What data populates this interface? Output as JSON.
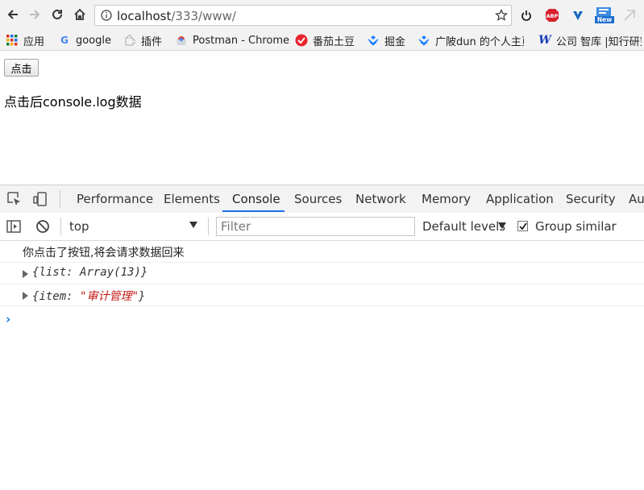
{
  "browser": {
    "url_host": "localhost",
    "url_path": "/333/www/",
    "bookmarks": [
      {
        "label": "应用",
        "icon": "apps-grid-icon"
      },
      {
        "label": "google",
        "icon": "google-icon"
      },
      {
        "label": "插件",
        "icon": "puzzle-icon"
      },
      {
        "label": "Postman - Chrome",
        "icon": "chrome-webstore-icon"
      },
      {
        "label": "番茄土豆",
        "icon": "tomato-icon"
      },
      {
        "label": "掘金",
        "icon": "juejin-icon"
      },
      {
        "label": "广陂dun 的个人主页",
        "icon": "juejin-icon"
      },
      {
        "label": "公司 智库 |知行研究",
        "icon": "w-logo-icon"
      }
    ]
  },
  "page": {
    "button_label": "点击",
    "text": "点击后console.log数据"
  },
  "devtools": {
    "tabs": [
      "Performance",
      "Elements",
      "Console",
      "Sources",
      "Network",
      "Memory",
      "Application",
      "Security",
      "Au"
    ],
    "active_tab": "Console",
    "context": "top",
    "filter_placeholder": "Filter",
    "levels": "Default levels",
    "group_similar_label": "Group similar",
    "group_similar_checked": true
  },
  "console": {
    "log_text": "你点击了按钮,将会请求数据回来",
    "obj1_open": "{",
    "obj1_key": "list",
    "obj1_value": "Array(13)",
    "obj1_close": "}",
    "obj2_open": "{",
    "obj2_key": "item",
    "obj2_value": "\"审计管理\"",
    "obj2_close": "}"
  },
  "colors": {
    "accent": "#1a73e8",
    "string": "#c41a16"
  }
}
